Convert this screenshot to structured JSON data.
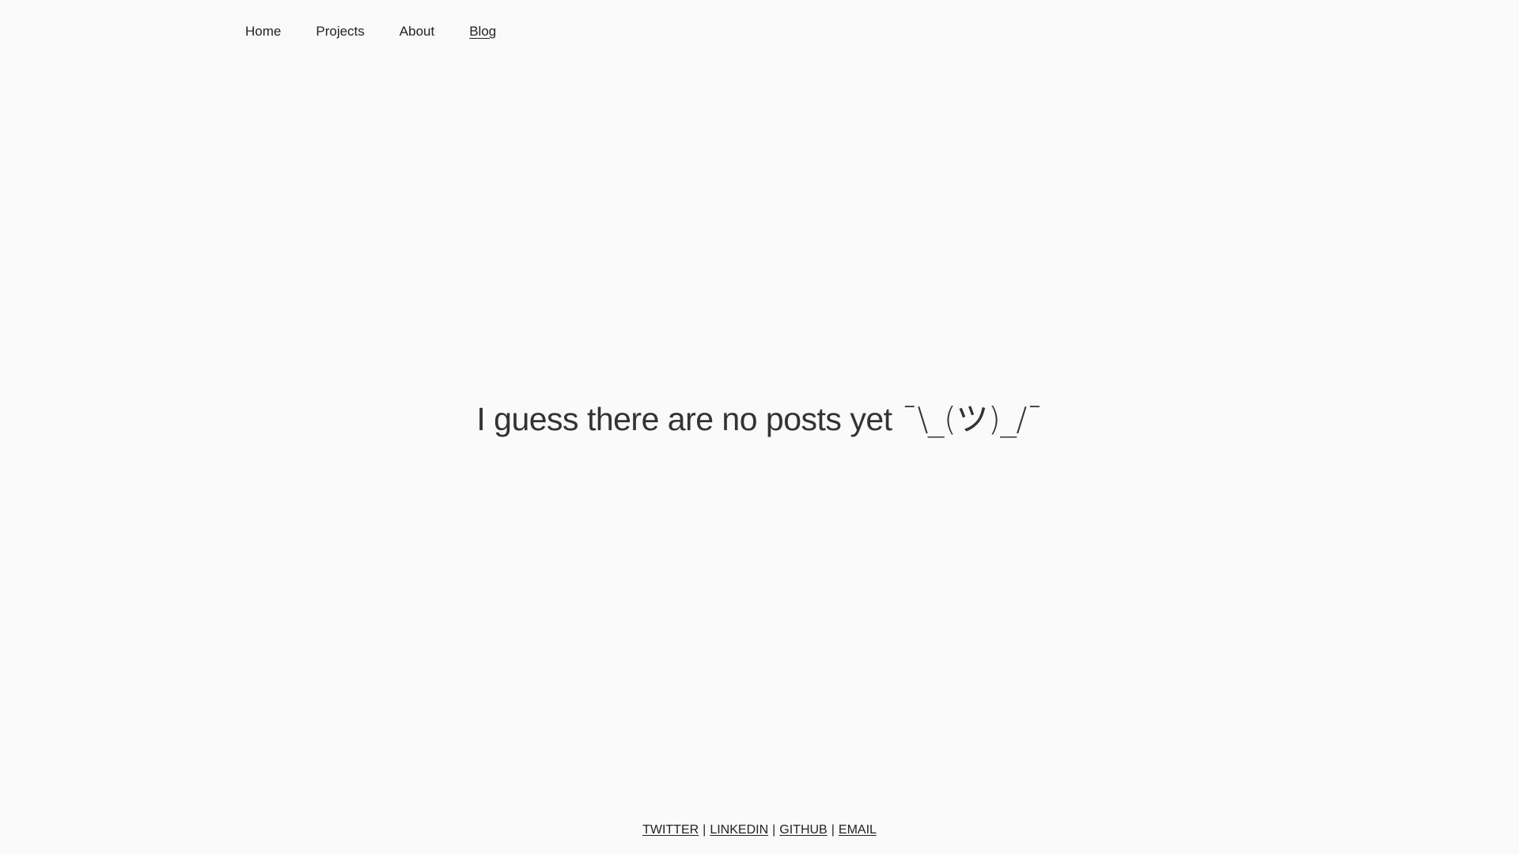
{
  "nav": {
    "items": [
      {
        "label": "Home",
        "active": false
      },
      {
        "label": "Projects",
        "active": false
      },
      {
        "label": "About",
        "active": false
      },
      {
        "label": "Blog",
        "active": true
      }
    ]
  },
  "main": {
    "empty_text": "I guess there are no posts yet",
    "shrug": "¯\\_(ツ)_/¯"
  },
  "footer": {
    "links": [
      "TWITTER",
      "LINKEDIN",
      "GITHUB",
      "EMAIL"
    ],
    "separator": "|"
  },
  "colors": {
    "background": "#fafafa",
    "text": "#222222"
  }
}
